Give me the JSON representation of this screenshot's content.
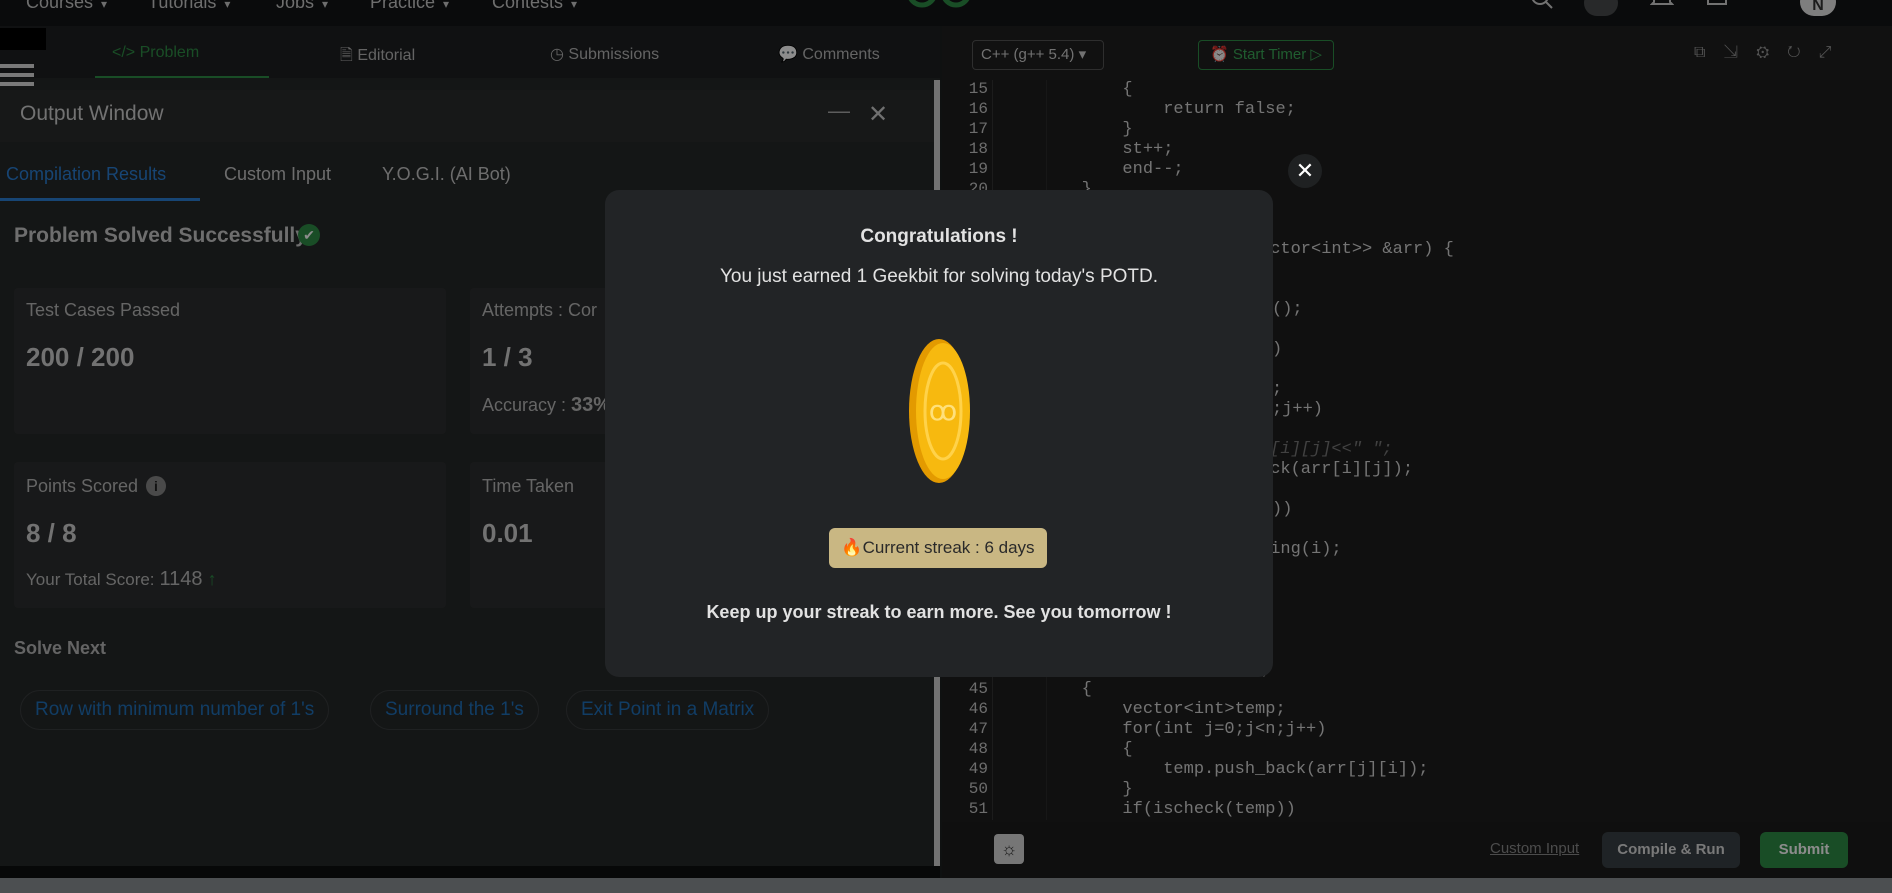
{
  "top_nav": {
    "items": [
      "Courses",
      "Tutorials",
      "Jobs",
      "Practice",
      "Contests"
    ],
    "avatar_letter": "N"
  },
  "left_tabs": [
    "Problem",
    "Editorial",
    "Submissions",
    "Comments"
  ],
  "output_window": {
    "title": "Output Window",
    "minimize_symbol": "—",
    "close_symbol": "✕"
  },
  "result_tabs": [
    "Compilation Results",
    "Custom Input",
    "Y.O.G.I. (AI Bot)"
  ],
  "status": {
    "title": "Problem Solved Successfully"
  },
  "cards": {
    "test_cases": {
      "label": "Test Cases Passed",
      "value": "200 / 200"
    },
    "attempts": {
      "label": "Attempts : Cor",
      "value": "1 / 3",
      "accuracy_label": "Accuracy :",
      "accuracy_value": "33%"
    },
    "points": {
      "label": "Points Scored",
      "value": "8 / 8",
      "total_label": "Your Total Score:",
      "total_value": "1148"
    },
    "time": {
      "label": "Time Taken",
      "value": "0.01"
    }
  },
  "solve_next": {
    "title": "Solve Next",
    "items": [
      "Row with minimum number of 1's",
      "Surround the 1's",
      "Exit Point in a Matrix"
    ]
  },
  "editor": {
    "language": "C++ (g++ 5.4)",
    "timer": "Start Timer",
    "code_lines_top": [
      {
        "n": "15",
        "t": "            {"
      },
      {
        "n": "16",
        "t": "                return false;"
      },
      {
        "n": "17",
        "t": "            }"
      },
      {
        "n": "18",
        "t": "            st++;"
      },
      {
        "n": "19",
        "t": "            end--;"
      },
      {
        "n": "20",
        "t": "        }"
      }
    ],
    "code_lines_bottom": [
      {
        "n": "45",
        "t": "        {"
      },
      {
        "n": "46",
        "t": "            vector<int>temp;"
      },
      {
        "n": "47",
        "t": "            for(int j=0;j<n;j++)"
      },
      {
        "n": "48",
        "t": "            {"
      },
      {
        "n": "49",
        "t": "                temp.push_back(arr[j][i]);"
      },
      {
        "n": "50",
        "t": "            }"
      },
      {
        "n": "51",
        "t": "            if(ischeck(temp))"
      }
    ],
    "code_fragments": [
      "ector<int>> &arr) {",
      "();",
      ")",
      ";",
      ";j++)",
      "r[i][j]<<\" \";",
      "ack(arr[i][j]);",
      "))",
      "ring(i);",
      ")"
    ],
    "custom_input_link": "Custom Input",
    "compile_button": "Compile & Run",
    "submit_button": "Submit"
  },
  "modal": {
    "title": "Congratulations !",
    "message": "You just earned 1 Geekbit for solving today's POTD.",
    "streak": "Current streak : 6 days",
    "footer": "Keep up your streak to earn more. See you tomorrow !",
    "close_symbol": "✕"
  },
  "colors": {
    "accent_green": "#2f8d46",
    "streak_bg": "#c9b783",
    "coin": "#f5b400",
    "link_blue": "#1f6fb8"
  }
}
